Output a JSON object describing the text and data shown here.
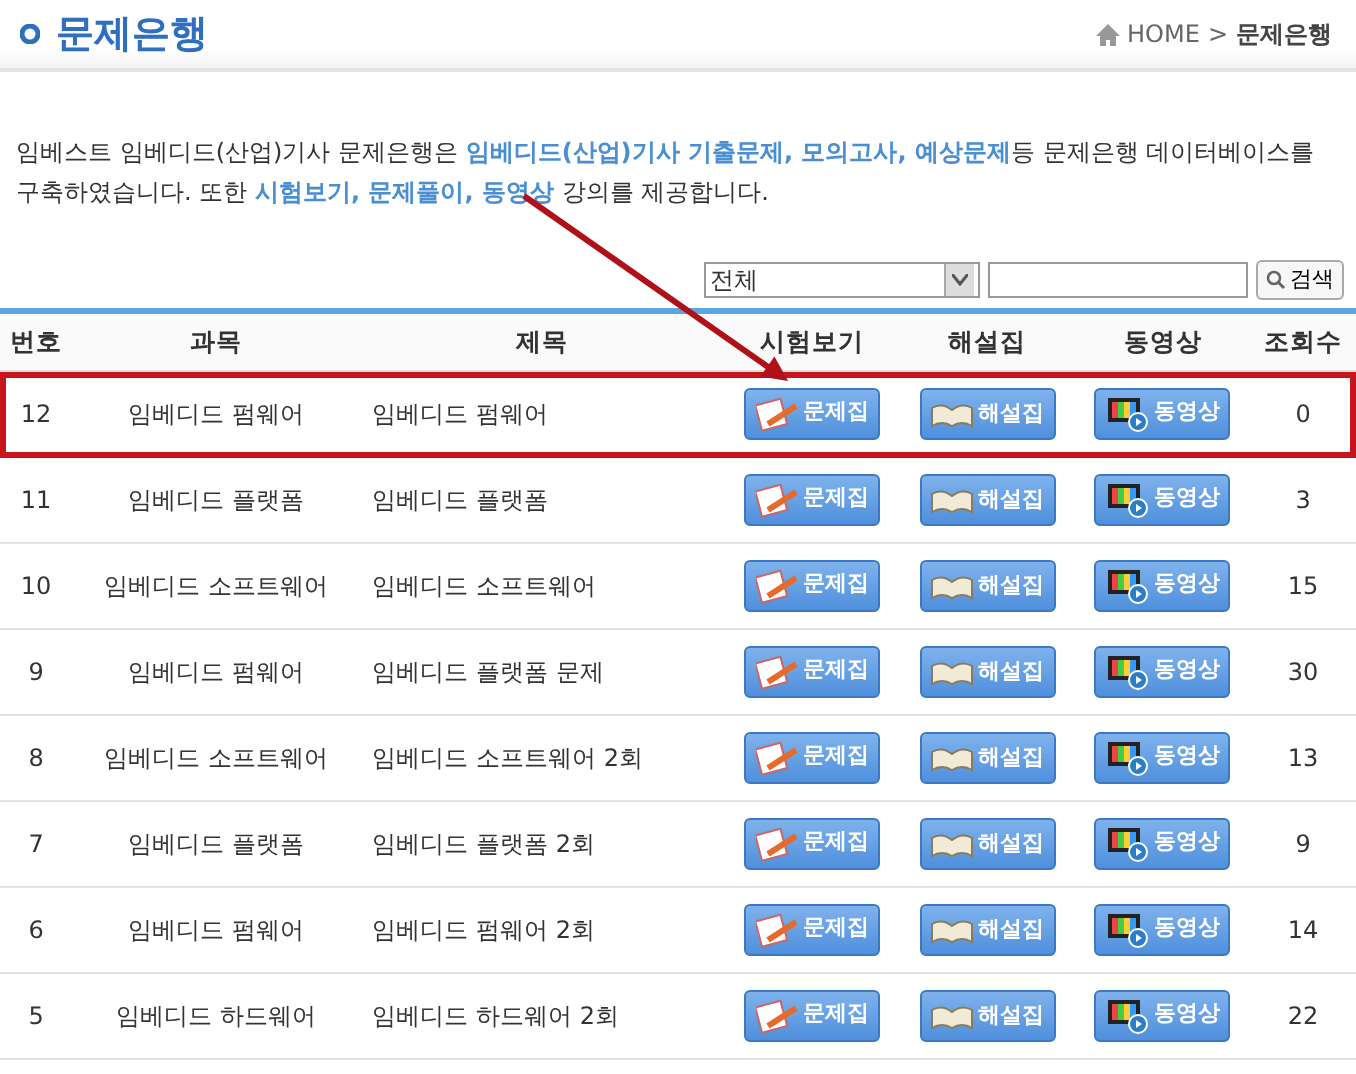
{
  "page_title": "문제은행",
  "breadcrumb": {
    "home": "HOME",
    "separator": ">",
    "current": "문제은행"
  },
  "intro": "임베스트 임베디드(산업)기사 문제은행은 **임베디드(산업)기사 기출문제, 모의고사, 예상문제**등 문제은행 데이터베이스를 구축하였습니다. 또한 **시험보기, 문제풀이, 동영상** 강의를 제공합니다.",
  "search": {
    "category": "전체",
    "button": "검색"
  },
  "columns": [
    "번호",
    "과목",
    "제목",
    "시험보기",
    "해설집",
    "동영상",
    "조회수"
  ],
  "rows": [
    {
      "no": "12",
      "subject": "임베디드 펌웨어",
      "title": "임베디드 펌웨어",
      "exam": "문제집",
      "solution": "해설집",
      "video": "동영상",
      "views": "0",
      "highlighted": true
    },
    {
      "no": "11",
      "subject": "임베디드 플랫폼",
      "title": "임베디드 플랫폼",
      "exam": "문제집",
      "solution": "해설집",
      "video": "동영상",
      "views": "3",
      "highlighted": false
    },
    {
      "no": "10",
      "subject": "임베디드 소프트웨어",
      "title": "임베디드 소프트웨어",
      "exam": "문제집",
      "solution": "해설집",
      "video": "동영상",
      "views": "15",
      "highlighted": false
    },
    {
      "no": "9",
      "subject": "임베디드 펌웨어",
      "title": "임베디드 플랫폼 문제",
      "exam": "문제집",
      "solution": "해설집",
      "video": "동영상",
      "views": "30",
      "highlighted": false
    },
    {
      "no": "8",
      "subject": "임베디드 소프트웨어",
      "title": "임베디드 소프트웨어 2회",
      "exam": "문제집",
      "solution": "해설집",
      "video": "동영상",
      "views": "13",
      "highlighted": false
    },
    {
      "no": "7",
      "subject": "임베디드 플랫폼",
      "title": "임베디드 플랫폼 2회",
      "exam": "문제집",
      "solution": "해설집",
      "video": "동영상",
      "views": "9",
      "highlighted": false
    },
    {
      "no": "6",
      "subject": "임베디드 펌웨어",
      "title": "임베디드 펌웨어 2회",
      "exam": "문제집",
      "solution": "해설집",
      "video": "동영상",
      "views": "14",
      "highlighted": false
    },
    {
      "no": "5",
      "subject": "임베디드 하드웨어",
      "title": "임베디드 하드웨어 2회",
      "exam": "문제집",
      "solution": "해설집",
      "video": "동영상",
      "views": "22",
      "highlighted": false
    }
  ]
}
